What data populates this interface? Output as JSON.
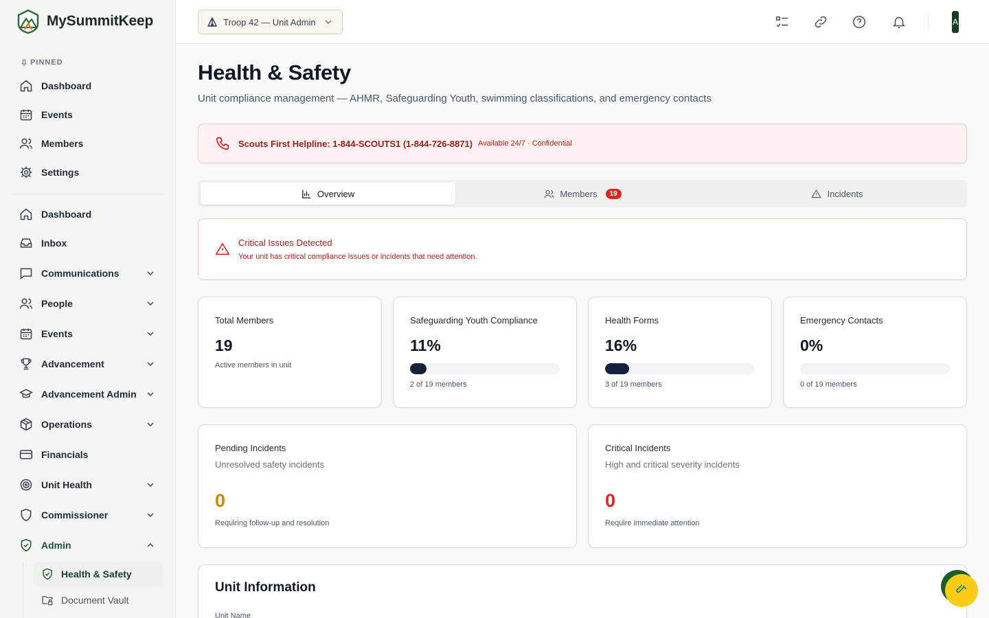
{
  "brand": {
    "name": "MySummitKeep"
  },
  "sidebar": {
    "pinned_label": "PINNED",
    "pinned": [
      {
        "label": "Dashboard",
        "icon": "home-icon"
      },
      {
        "label": "Events",
        "icon": "calendar-icon"
      },
      {
        "label": "Members",
        "icon": "users-icon"
      },
      {
        "label": "Settings",
        "icon": "gear-icon"
      }
    ],
    "items": [
      {
        "label": "Dashboard",
        "icon": "home-icon"
      },
      {
        "label": "Inbox",
        "icon": "inbox-icon"
      },
      {
        "label": "Communications",
        "icon": "message-icon"
      },
      {
        "label": "People",
        "icon": "users-icon"
      },
      {
        "label": "Events",
        "icon": "calendar-icon"
      },
      {
        "label": "Advancement",
        "icon": "trophy-icon"
      },
      {
        "label": "Advancement Admin",
        "icon": "graduation-cap-icon"
      },
      {
        "label": "Operations",
        "icon": "package-icon"
      },
      {
        "label": "Financials",
        "icon": "credit-card-icon"
      },
      {
        "label": "Unit Health",
        "icon": "target-icon"
      },
      {
        "label": "Commissioner",
        "icon": "shield-icon"
      },
      {
        "label": "Admin",
        "icon": "shield-check-icon"
      }
    ],
    "admin_sub": [
      {
        "label": "Health & Safety",
        "icon": "shield-check-icon",
        "active": true
      },
      {
        "label": "Document Vault",
        "icon": "folder-lock-icon",
        "active": false
      }
    ]
  },
  "topbar": {
    "unit_selector": "Troop 42 — Unit Admin",
    "avatar_initial": "A"
  },
  "page": {
    "title": "Health & Safety",
    "subtitle": "Unit compliance management — AHMR, Safeguarding Youth, swimming classifications, and emergency contacts"
  },
  "helpline": {
    "text": "Scouts First Helpline: 1-844-SCOUTS1 (1-844-726-8871)",
    "sub": "Available 24/7 · Confidential"
  },
  "tabs": [
    {
      "label": "Overview",
      "active": true
    },
    {
      "label": "Members",
      "badge": "19"
    },
    {
      "label": "Incidents"
    }
  ],
  "alert": {
    "title": "Critical Issues Detected",
    "desc": "Your unit has critical compliance issues or incidents that need attention."
  },
  "stats": [
    {
      "title": "Total Members",
      "value": "19",
      "note": "Active members in unit"
    },
    {
      "title": "Safeguarding Youth Compliance",
      "value": "11%",
      "progress": 0.11,
      "note": "2 of 19 members"
    },
    {
      "title": "Health Forms",
      "value": "16%",
      "progress": 0.16,
      "note": "3 of 19 members"
    },
    {
      "title": "Emergency Contacts",
      "value": "0%",
      "progress": 0,
      "note": "0 of 19 members"
    }
  ],
  "incidents": [
    {
      "title": "Pending Incidents",
      "sub": "Unresolved safety incidents",
      "value": "0",
      "note": "Requiring follow-up and resolution",
      "color": "#ca8a04"
    },
    {
      "title": "Critical Incidents",
      "sub": "High and critical severity incidents",
      "value": "0",
      "note": "Require immediate attention",
      "color": "#dc2626"
    }
  ],
  "unit_info": {
    "title": "Unit Information",
    "field_label": "Unit Name"
  },
  "colors": {
    "brand_green": "#1b5e2e",
    "danger": "#dc2626",
    "warning": "#ca8a04",
    "progress": "#14213d"
  }
}
